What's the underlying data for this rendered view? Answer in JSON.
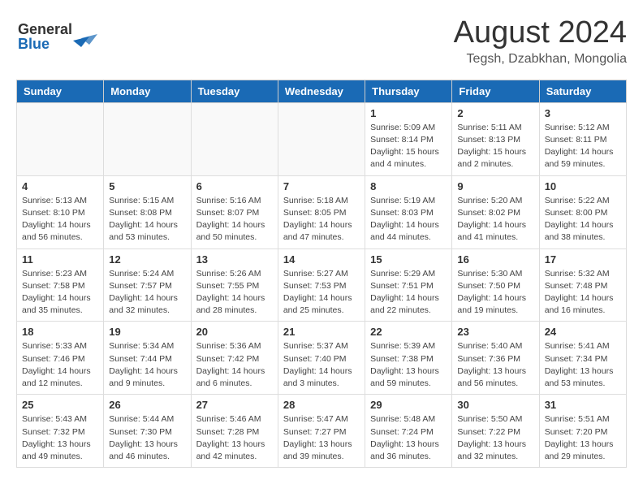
{
  "header": {
    "logo_line1": "General",
    "logo_line2": "Blue",
    "month": "August 2024",
    "location": "Tegsh, Dzabkhan, Mongolia"
  },
  "days_of_week": [
    "Sunday",
    "Monday",
    "Tuesday",
    "Wednesday",
    "Thursday",
    "Friday",
    "Saturday"
  ],
  "weeks": [
    [
      {
        "day": "",
        "info": ""
      },
      {
        "day": "",
        "info": ""
      },
      {
        "day": "",
        "info": ""
      },
      {
        "day": "",
        "info": ""
      },
      {
        "day": "1",
        "info": "Sunrise: 5:09 AM\nSunset: 8:14 PM\nDaylight: 15 hours\nand 4 minutes."
      },
      {
        "day": "2",
        "info": "Sunrise: 5:11 AM\nSunset: 8:13 PM\nDaylight: 15 hours\nand 2 minutes."
      },
      {
        "day": "3",
        "info": "Sunrise: 5:12 AM\nSunset: 8:11 PM\nDaylight: 14 hours\nand 59 minutes."
      }
    ],
    [
      {
        "day": "4",
        "info": "Sunrise: 5:13 AM\nSunset: 8:10 PM\nDaylight: 14 hours\nand 56 minutes."
      },
      {
        "day": "5",
        "info": "Sunrise: 5:15 AM\nSunset: 8:08 PM\nDaylight: 14 hours\nand 53 minutes."
      },
      {
        "day": "6",
        "info": "Sunrise: 5:16 AM\nSunset: 8:07 PM\nDaylight: 14 hours\nand 50 minutes."
      },
      {
        "day": "7",
        "info": "Sunrise: 5:18 AM\nSunset: 8:05 PM\nDaylight: 14 hours\nand 47 minutes."
      },
      {
        "day": "8",
        "info": "Sunrise: 5:19 AM\nSunset: 8:03 PM\nDaylight: 14 hours\nand 44 minutes."
      },
      {
        "day": "9",
        "info": "Sunrise: 5:20 AM\nSunset: 8:02 PM\nDaylight: 14 hours\nand 41 minutes."
      },
      {
        "day": "10",
        "info": "Sunrise: 5:22 AM\nSunset: 8:00 PM\nDaylight: 14 hours\nand 38 minutes."
      }
    ],
    [
      {
        "day": "11",
        "info": "Sunrise: 5:23 AM\nSunset: 7:58 PM\nDaylight: 14 hours\nand 35 minutes."
      },
      {
        "day": "12",
        "info": "Sunrise: 5:24 AM\nSunset: 7:57 PM\nDaylight: 14 hours\nand 32 minutes."
      },
      {
        "day": "13",
        "info": "Sunrise: 5:26 AM\nSunset: 7:55 PM\nDaylight: 14 hours\nand 28 minutes."
      },
      {
        "day": "14",
        "info": "Sunrise: 5:27 AM\nSunset: 7:53 PM\nDaylight: 14 hours\nand 25 minutes."
      },
      {
        "day": "15",
        "info": "Sunrise: 5:29 AM\nSunset: 7:51 PM\nDaylight: 14 hours\nand 22 minutes."
      },
      {
        "day": "16",
        "info": "Sunrise: 5:30 AM\nSunset: 7:50 PM\nDaylight: 14 hours\nand 19 minutes."
      },
      {
        "day": "17",
        "info": "Sunrise: 5:32 AM\nSunset: 7:48 PM\nDaylight: 14 hours\nand 16 minutes."
      }
    ],
    [
      {
        "day": "18",
        "info": "Sunrise: 5:33 AM\nSunset: 7:46 PM\nDaylight: 14 hours\nand 12 minutes."
      },
      {
        "day": "19",
        "info": "Sunrise: 5:34 AM\nSunset: 7:44 PM\nDaylight: 14 hours\nand 9 minutes."
      },
      {
        "day": "20",
        "info": "Sunrise: 5:36 AM\nSunset: 7:42 PM\nDaylight: 14 hours\nand 6 minutes."
      },
      {
        "day": "21",
        "info": "Sunrise: 5:37 AM\nSunset: 7:40 PM\nDaylight: 14 hours\nand 3 minutes."
      },
      {
        "day": "22",
        "info": "Sunrise: 5:39 AM\nSunset: 7:38 PM\nDaylight: 13 hours\nand 59 minutes."
      },
      {
        "day": "23",
        "info": "Sunrise: 5:40 AM\nSunset: 7:36 PM\nDaylight: 13 hours\nand 56 minutes."
      },
      {
        "day": "24",
        "info": "Sunrise: 5:41 AM\nSunset: 7:34 PM\nDaylight: 13 hours\nand 53 minutes."
      }
    ],
    [
      {
        "day": "25",
        "info": "Sunrise: 5:43 AM\nSunset: 7:32 PM\nDaylight: 13 hours\nand 49 minutes."
      },
      {
        "day": "26",
        "info": "Sunrise: 5:44 AM\nSunset: 7:30 PM\nDaylight: 13 hours\nand 46 minutes."
      },
      {
        "day": "27",
        "info": "Sunrise: 5:46 AM\nSunset: 7:28 PM\nDaylight: 13 hours\nand 42 minutes."
      },
      {
        "day": "28",
        "info": "Sunrise: 5:47 AM\nSunset: 7:27 PM\nDaylight: 13 hours\nand 39 minutes."
      },
      {
        "day": "29",
        "info": "Sunrise: 5:48 AM\nSunset: 7:24 PM\nDaylight: 13 hours\nand 36 minutes."
      },
      {
        "day": "30",
        "info": "Sunrise: 5:50 AM\nSunset: 7:22 PM\nDaylight: 13 hours\nand 32 minutes."
      },
      {
        "day": "31",
        "info": "Sunrise: 5:51 AM\nSunset: 7:20 PM\nDaylight: 13 hours\nand 29 minutes."
      }
    ]
  ]
}
